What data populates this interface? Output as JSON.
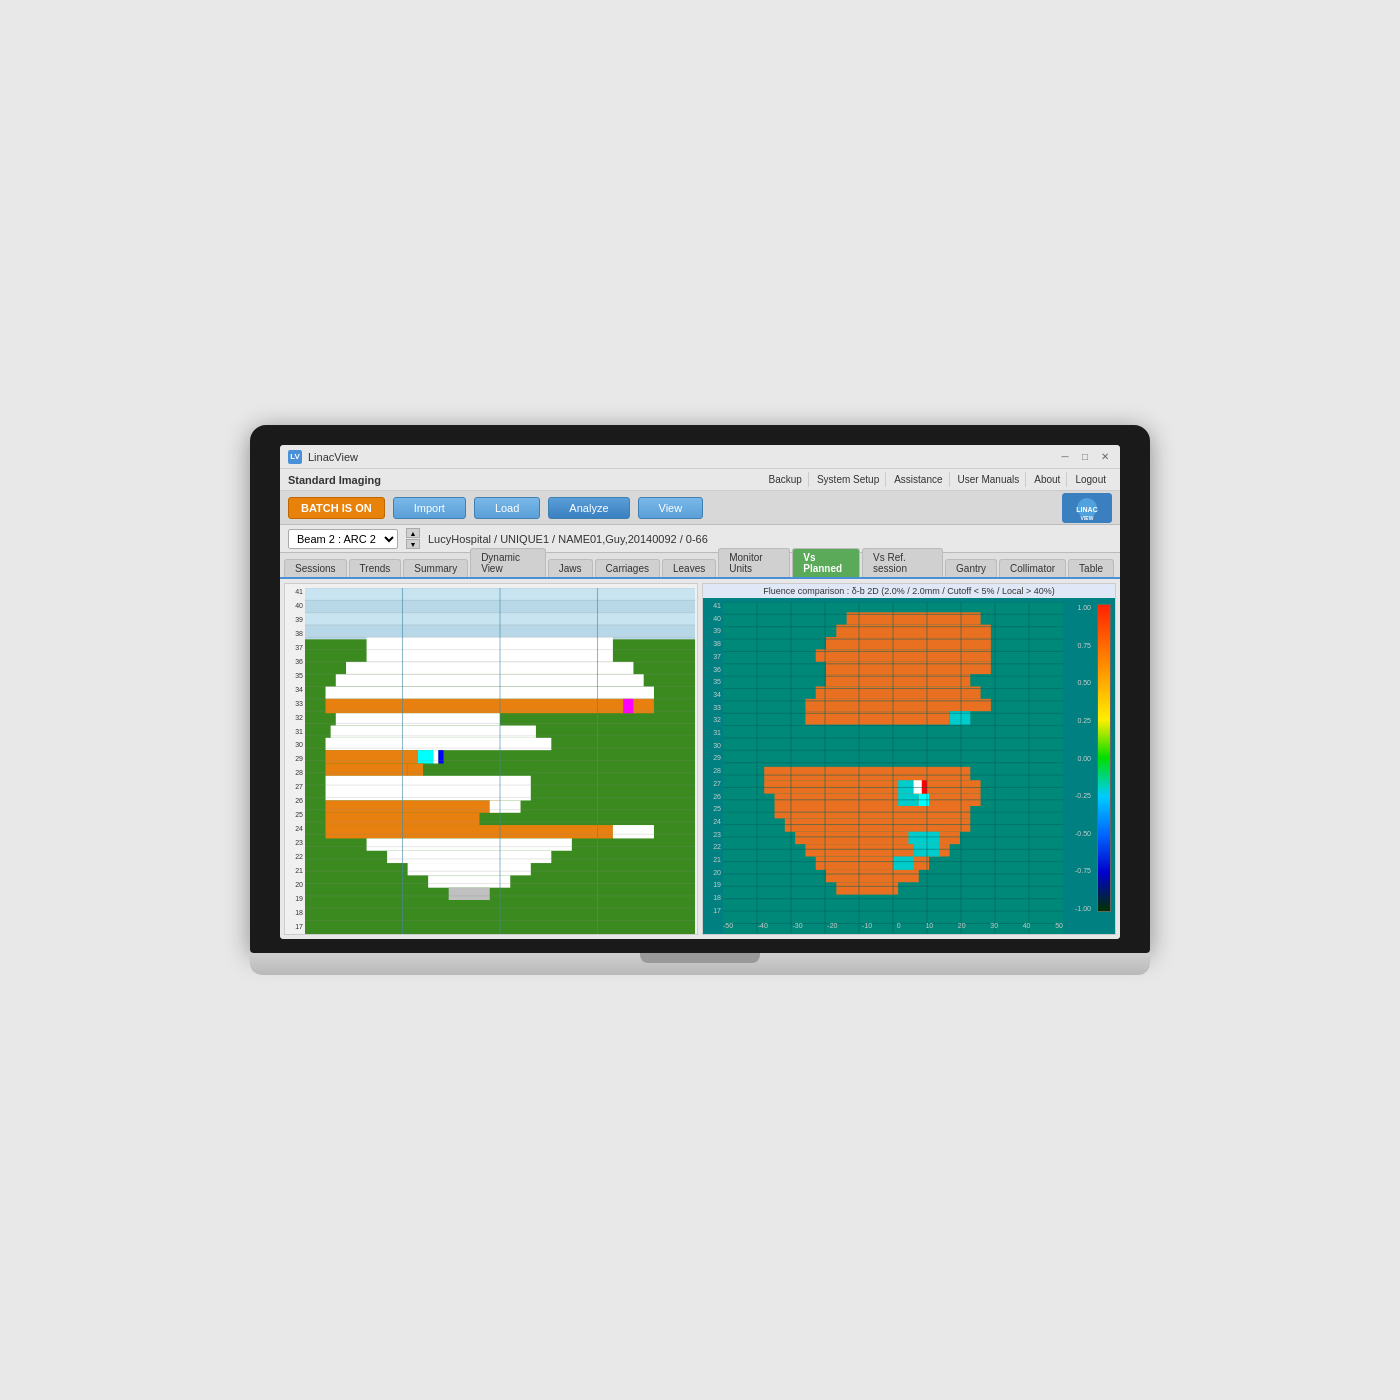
{
  "app": {
    "title": "LinacView",
    "brand": "Standard Imaging",
    "logo_text": "LINACVIEW"
  },
  "title_bar": {
    "minimize": "─",
    "restore": "□",
    "close": "✕"
  },
  "menu": {
    "items": [
      "Backup",
      "System Setup",
      "Assistance",
      "User Manuals",
      "About",
      "Logout"
    ]
  },
  "toolbar": {
    "batch_label": "BATCH IS ON",
    "import_label": "Import",
    "load_label": "Load",
    "analyze_label": "Analyze",
    "view_label": "View"
  },
  "beam": {
    "selector": "Beam 2 : ARC 2",
    "path": "LucyHospital / UNIQUE1 / NAME01,Guy,20140092 / 0-66"
  },
  "tabs": [
    {
      "id": "sessions",
      "label": "Sessions",
      "state": "normal"
    },
    {
      "id": "trends",
      "label": "Trends",
      "state": "normal"
    },
    {
      "id": "summary",
      "label": "Summary",
      "state": "normal"
    },
    {
      "id": "dynamic-view",
      "label": "Dynamic View",
      "state": "normal"
    },
    {
      "id": "jaws",
      "label": "Jaws",
      "state": "normal"
    },
    {
      "id": "carriages",
      "label": "Carriages",
      "state": "normal"
    },
    {
      "id": "leaves",
      "label": "Leaves",
      "state": "normal"
    },
    {
      "id": "monitor-units",
      "label": "Monitor Units",
      "state": "normal"
    },
    {
      "id": "vs-planned",
      "label": "Vs Planned",
      "state": "active-green"
    },
    {
      "id": "vs-ref-session",
      "label": "Vs Ref. session",
      "state": "normal"
    },
    {
      "id": "gantry",
      "label": "Gantry",
      "state": "normal"
    },
    {
      "id": "collimator",
      "label": "Collimator",
      "state": "normal"
    },
    {
      "id": "table",
      "label": "Table",
      "state": "normal"
    }
  ],
  "chart": {
    "right_title": "Fluence comparison : δ-b 2D (2.0% / 2.0mm / Cutoff < 5% / Local > 40%)",
    "colorbar_values": [
      "1.00",
      "0.75",
      "0.50",
      "0.25",
      "0.00",
      "-0.25",
      "-0.50",
      "-0.75",
      "-1.00"
    ],
    "y_labels": [
      "41",
      "40",
      "39",
      "38",
      "37",
      "36",
      "35",
      "34",
      "33",
      "32",
      "31",
      "30",
      "29",
      "28",
      "27",
      "26",
      "25",
      "24",
      "23",
      "22",
      "21",
      "20",
      "19",
      "18",
      "17"
    ],
    "x_labels_right": [
      "-50",
      "-40",
      "-30",
      "-20",
      "-10",
      "0",
      "10",
      "20",
      "30",
      "40",
      "50"
    ]
  }
}
